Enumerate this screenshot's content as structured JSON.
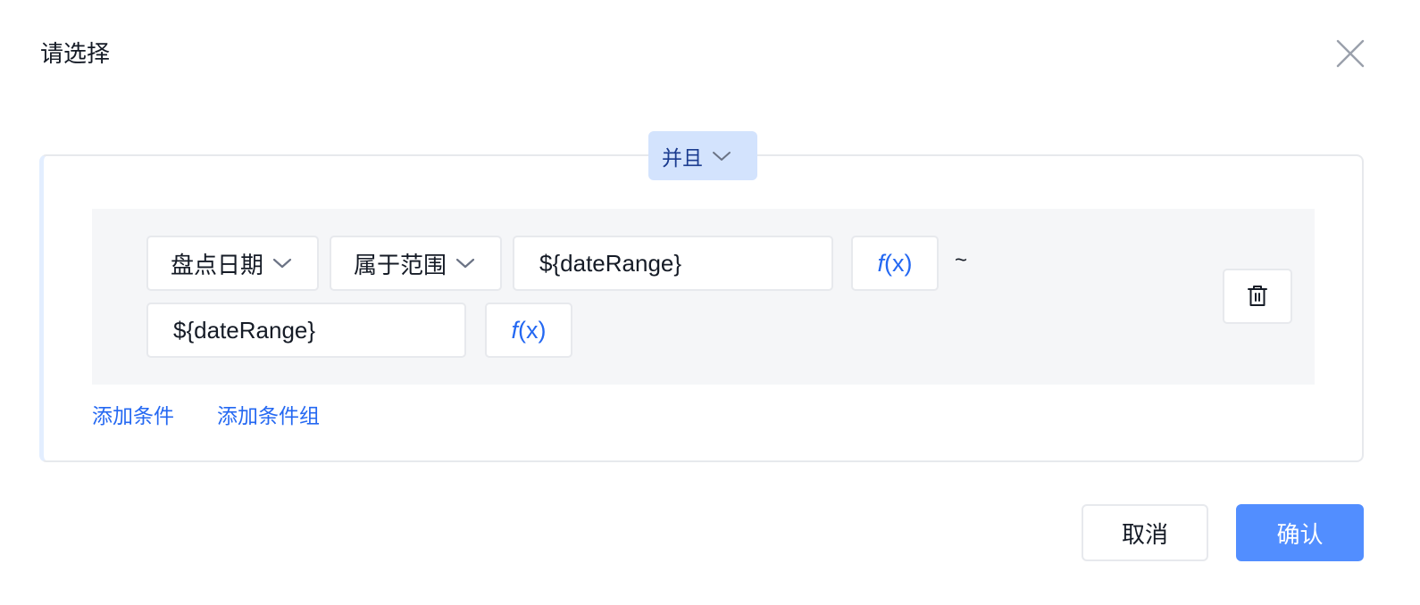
{
  "dialog": {
    "title": "请选择"
  },
  "condition_group": {
    "conjunction": "并且",
    "condition": {
      "field": "盘点日期",
      "operator": "属于范围",
      "value_start": "${dateRange}",
      "range_separator": "~",
      "value_end": "${dateRange}",
      "formula_label": "f",
      "formula_paren": "(x)"
    },
    "add_condition_label": "添加条件",
    "add_group_label": "添加条件组"
  },
  "footer": {
    "cancel_label": "取消",
    "confirm_label": "确认"
  },
  "colors": {
    "accent": "#2468f2",
    "primary_button": "#528eff",
    "conjunction_bg": "#d3e3fd",
    "panel_bg": "#f5f6f8"
  },
  "icons": [
    "close-icon",
    "chevron-down-icon",
    "trash-icon"
  ]
}
